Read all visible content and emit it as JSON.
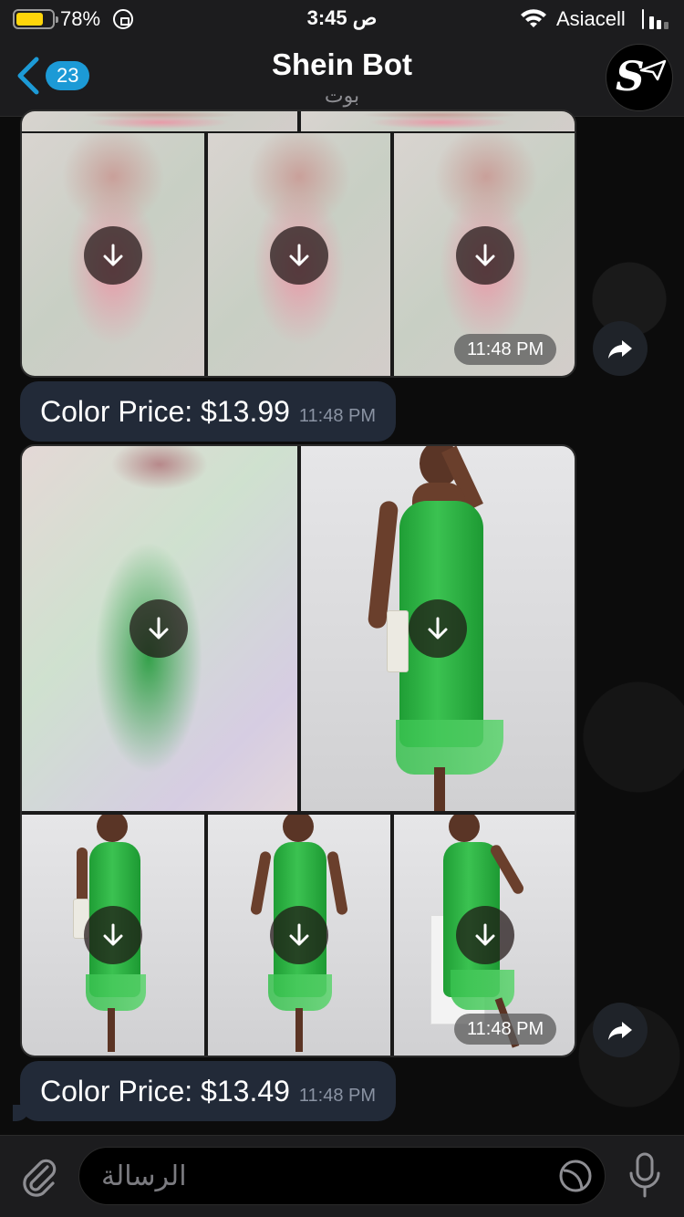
{
  "status_bar": {
    "battery_percent": "78%",
    "battery_level": 0.78,
    "time": "3:45 ص",
    "carrier": "Asiacell"
  },
  "header": {
    "back_badge": "23",
    "title": "Shein Bot",
    "subtitle": "بوت",
    "avatar_icon": "shein-bot-logo"
  },
  "albums": [
    {
      "time": "11:48 PM",
      "tiles": [
        "blurred-pink-dress",
        "blurred-pink-dress",
        "blurred-pink-dress"
      ]
    },
    {
      "time": "11:48 PM",
      "tiles": [
        "blurred-green-dress",
        "green-dress-photo",
        "green-dress-photo",
        "green-dress-photo",
        "green-dress-photo"
      ]
    }
  ],
  "messages": [
    {
      "text": "Color Price: $13.99",
      "time": "11:48 PM"
    },
    {
      "text": "Color Price: $13.49",
      "time": "11:48 PM"
    }
  ],
  "input": {
    "placeholder": "الرسالة"
  },
  "colors": {
    "accent": "#1c9ad6",
    "bubble": "#222a38",
    "bar": "#1c1c1e"
  }
}
